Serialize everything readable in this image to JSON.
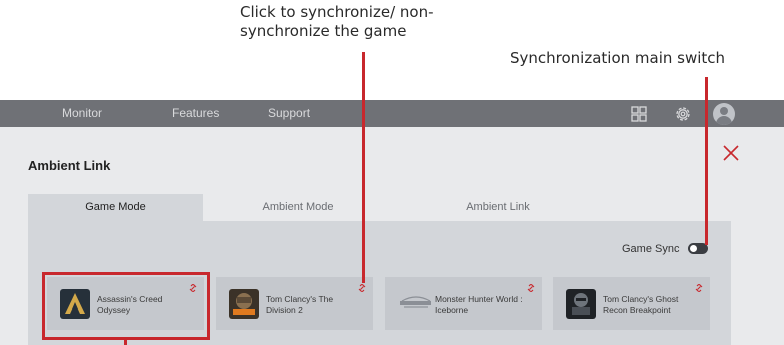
{
  "annotations": {
    "sync_game_line1": "Click to synchronize/ non-",
    "sync_game_line2": "synchronize the game",
    "main_switch": "Synchronization main switch"
  },
  "nav": {
    "items": [
      "Monitor",
      "Features",
      "Support"
    ],
    "icons": [
      "grid-icon",
      "gear-icon",
      "user-avatar-icon"
    ]
  },
  "panel": {
    "title": "Ambient Link",
    "close_icon": "close-icon"
  },
  "tabs": [
    {
      "label": "Game Mode",
      "active": true
    },
    {
      "label": "Ambient Mode",
      "active": false
    },
    {
      "label": "Ambient Link",
      "active": false
    }
  ],
  "game_sync": {
    "label": "Game Sync",
    "state": "on"
  },
  "games": [
    {
      "name": "Assassin's Creed Odyssey",
      "selected": true,
      "link_icon": "link-icon"
    },
    {
      "name": "Tom Clancy's The Division 2",
      "selected": false,
      "link_icon": "link-icon"
    },
    {
      "name": "Monster Hunter World : Iceborne",
      "selected": false,
      "link_icon": "link-icon"
    },
    {
      "name": "Tom Clancy's Ghost Recon Breakpoint",
      "selected": false,
      "link_icon": "link-icon"
    }
  ],
  "colors": {
    "accent": "#c8282d",
    "topbar": "#6f7176",
    "panel_bg": "#e9eaec",
    "content_bg": "#d3d6da"
  }
}
